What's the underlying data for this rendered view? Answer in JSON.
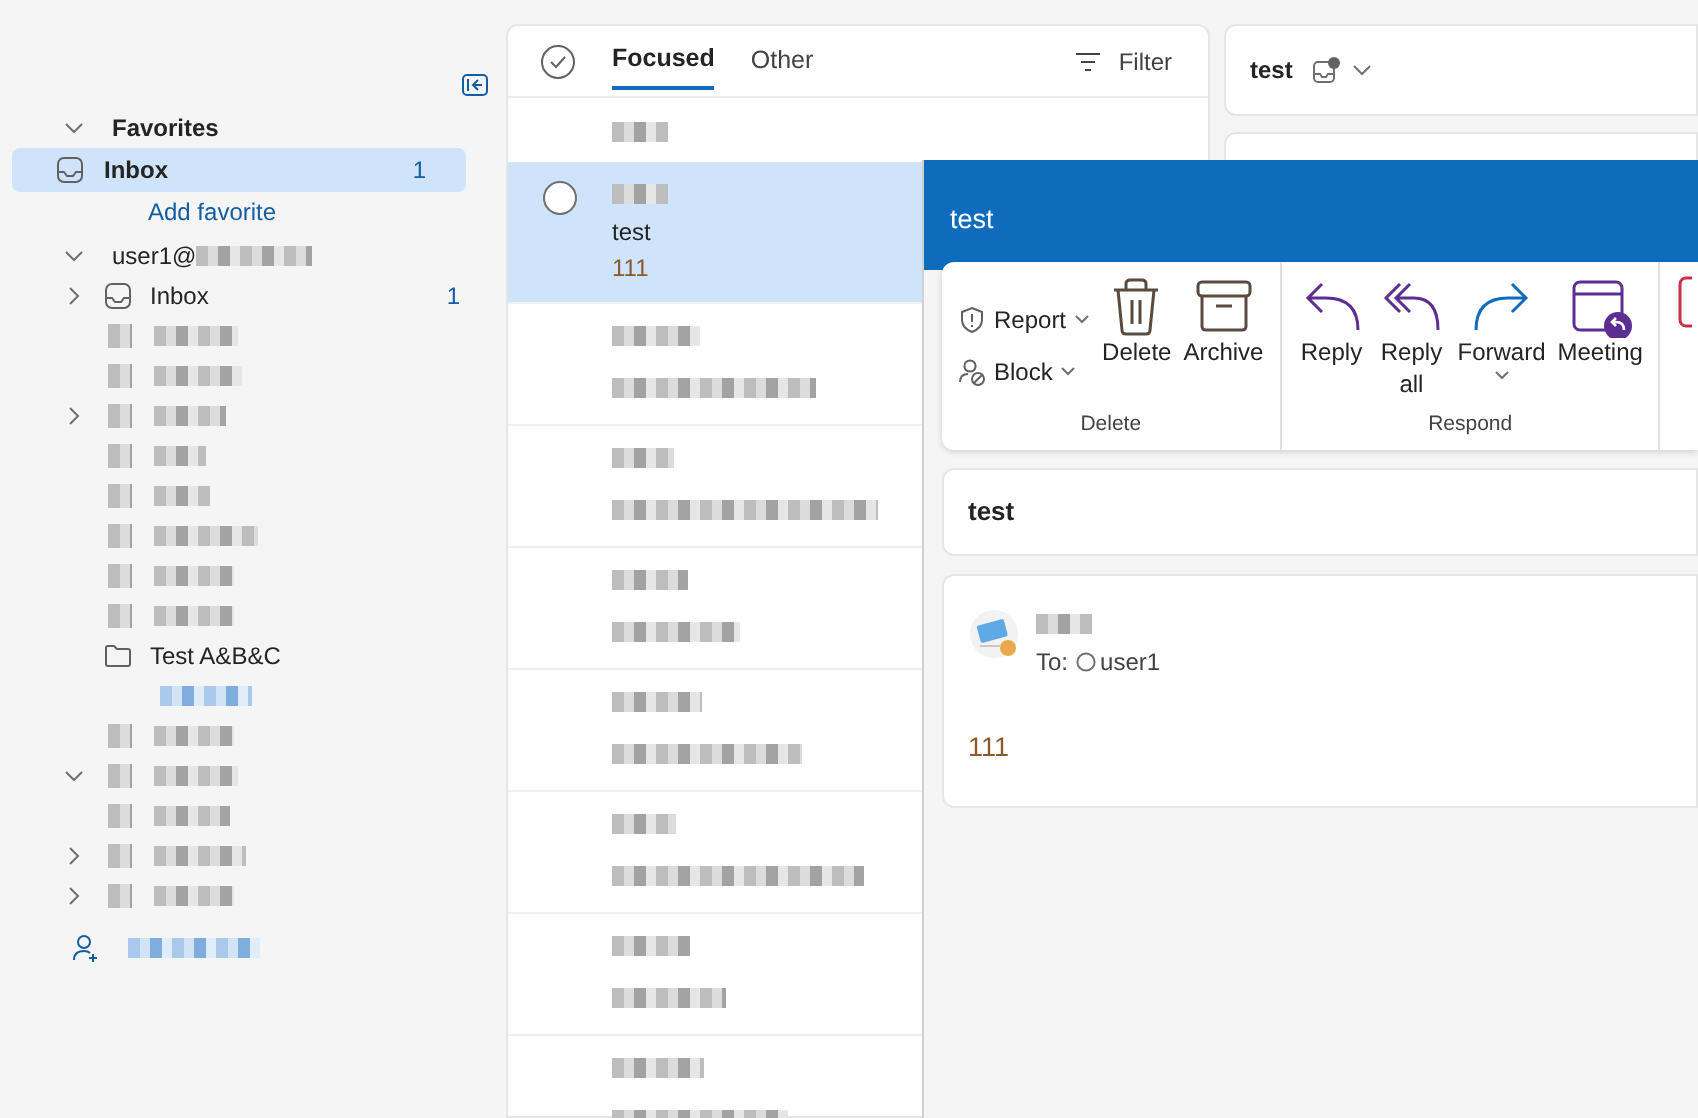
{
  "sidebar": {
    "favorites": {
      "title": "Favorites",
      "expanded": true,
      "items": [
        {
          "label": "Inbox",
          "count": "1",
          "selected": true
        }
      ],
      "add_link": "Add favorite"
    },
    "account": {
      "name": "user1@",
      "expanded": true,
      "folders": [
        {
          "kind": "folder",
          "label": "Inbox",
          "count": "1",
          "expanded": false
        },
        {
          "kind": "redacted"
        },
        {
          "kind": "redacted"
        },
        {
          "kind": "redacted",
          "expanded": false
        },
        {
          "kind": "redacted"
        },
        {
          "kind": "redacted"
        },
        {
          "kind": "redacted"
        },
        {
          "kind": "redacted"
        },
        {
          "kind": "redacted"
        },
        {
          "kind": "folder",
          "label": "Test A&B&C"
        },
        {
          "kind": "redacted-link"
        },
        {
          "kind": "redacted"
        },
        {
          "kind": "redacted",
          "expanded": true
        },
        {
          "kind": "redacted"
        },
        {
          "kind": "redacted",
          "expanded": false
        },
        {
          "kind": "redacted",
          "expanded": false
        }
      ]
    },
    "add_account": {
      "kind": "redacted-link"
    }
  },
  "message_list": {
    "tabs": [
      {
        "label": "Focused",
        "selected": true
      },
      {
        "label": "Other",
        "selected": false
      }
    ],
    "filter": "Filter",
    "rows": [
      {
        "kind": "header"
      },
      {
        "kind": "message",
        "subject": "test",
        "preview": "111",
        "selected": true
      },
      {
        "kind": "redacted",
        "selected": false
      },
      {
        "kind": "redacted",
        "selected": false
      },
      {
        "kind": "redacted",
        "selected": false
      },
      {
        "kind": "redacted",
        "selected": false
      },
      {
        "kind": "redacted",
        "selected": false
      },
      {
        "kind": "redacted",
        "selected": false
      },
      {
        "kind": "redacted",
        "selected": false
      }
    ]
  },
  "reading_pane": {
    "subject": "test"
  },
  "message_window": {
    "title": "test",
    "ribbon": [
      {
        "label": "Delete",
        "buttons": [
          {
            "kind": "small",
            "label": "Report",
            "dropdown": true
          },
          {
            "kind": "small",
            "label": "Block",
            "dropdown": true
          },
          {
            "kind": "large",
            "label": "Delete",
            "dropdown": false
          },
          {
            "kind": "large",
            "label": "Archive",
            "dropdown": false
          }
        ]
      },
      {
        "label": "Respond",
        "buttons": [
          {
            "kind": "large",
            "label": "Reply",
            "dropdown": false
          },
          {
            "kind": "large",
            "label": "Reply all",
            "dropdown": false
          },
          {
            "kind": "large",
            "label": "Forward",
            "dropdown": true
          },
          {
            "kind": "large",
            "label": "Meeting",
            "dropdown": false
          }
        ]
      }
    ],
    "subject": "test",
    "message": {
      "to_label": "To:",
      "recipient": "user1",
      "body": "111"
    }
  }
}
